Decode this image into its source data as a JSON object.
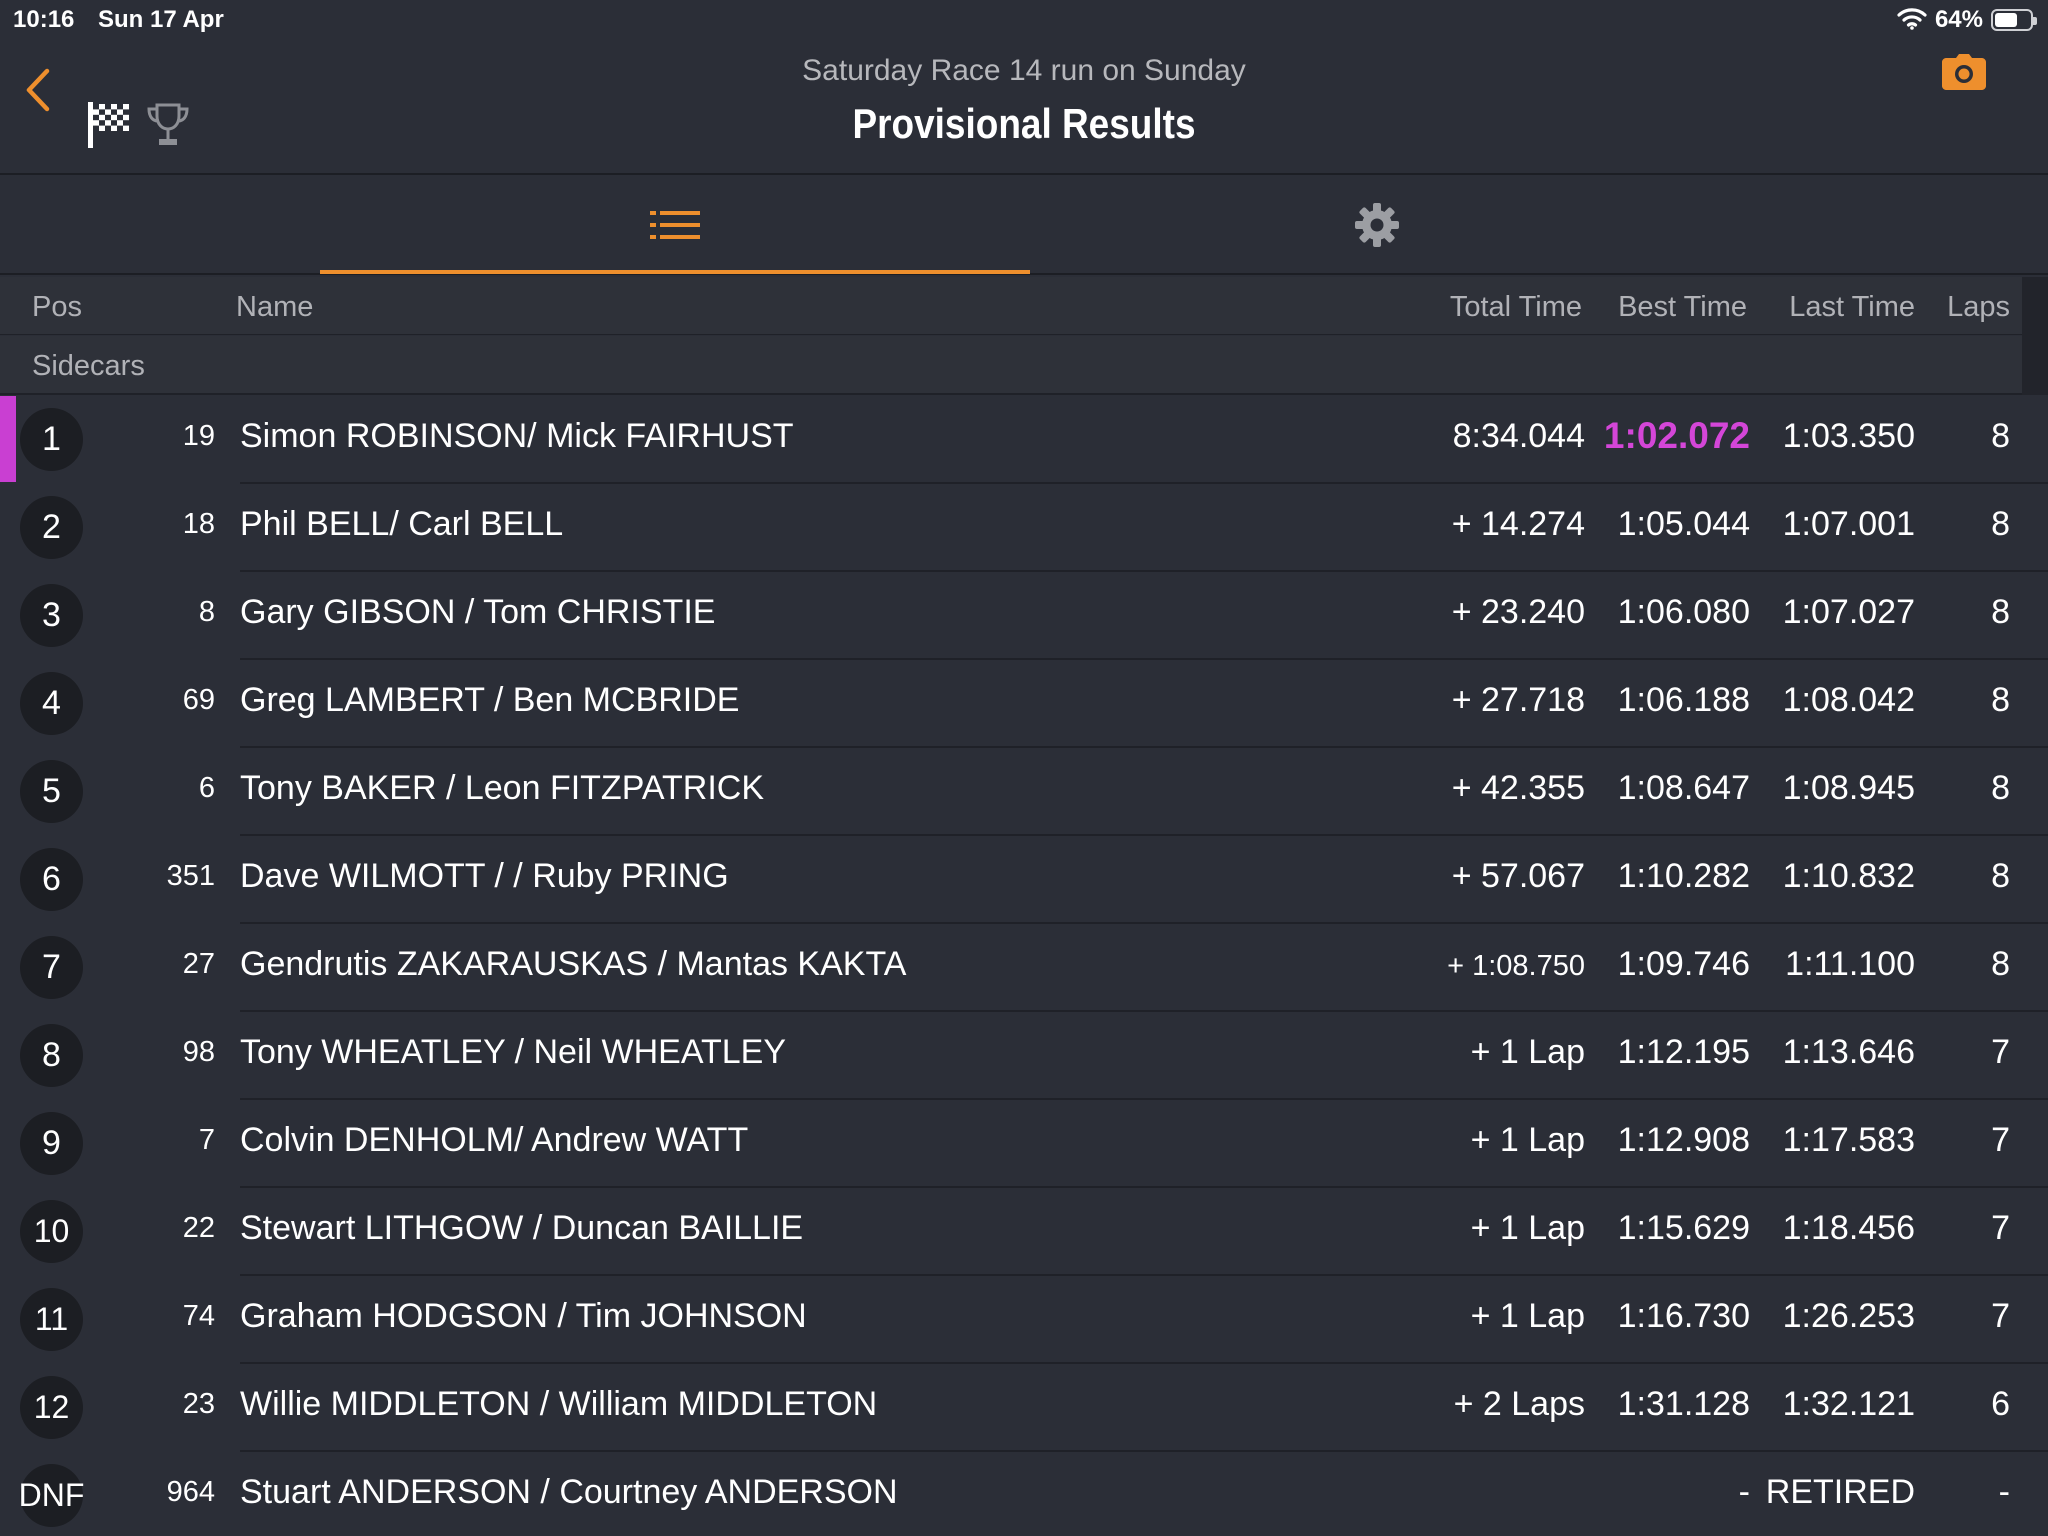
{
  "status_bar": {
    "time": "10:16",
    "date": "Sun 17 Apr",
    "battery": "64%",
    "battery_level": 0.64
  },
  "header": {
    "subtitle": "Saturday Race 14 run on Sunday",
    "title": "Provisional Results",
    "accent_color": "#ee8f2d"
  },
  "tabs": [
    {
      "icon": "list-icon",
      "active": true
    },
    {
      "icon": "gear-icon",
      "active": false
    }
  ],
  "columns": {
    "pos": "Pos",
    "name": "Name",
    "total": "Total Time",
    "best": "Best Time",
    "last": "Last Time",
    "laps": "Laps"
  },
  "category": "Sidecars",
  "fastest_color": "#d446d8",
  "rows": [
    {
      "pos": "1",
      "num": "19",
      "name": "Simon ROBINSON/ Mick FAIRHUST",
      "total": "8:34.044",
      "best": "1:02.072",
      "last": "1:03.350",
      "laps": "8"
    },
    {
      "pos": "2",
      "num": "18",
      "name": "Phil BELL/ Carl BELL",
      "total": "+ 14.274",
      "best": "1:05.044",
      "last": "1:07.001",
      "laps": "8"
    },
    {
      "pos": "3",
      "num": "8",
      "name": "Gary GIBSON / Tom CHRISTIE",
      "total": "+ 23.240",
      "best": "1:06.080",
      "last": "1:07.027",
      "laps": "8"
    },
    {
      "pos": "4",
      "num": "69",
      "name": "Greg LAMBERT / Ben MCBRIDE",
      "total": "+ 27.718",
      "best": "1:06.188",
      "last": "1:08.042",
      "laps": "8"
    },
    {
      "pos": "5",
      "num": "6",
      "name": "Tony BAKER / Leon FITZPATRICK",
      "total": "+ 42.355",
      "best": "1:08.647",
      "last": "1:08.945",
      "laps": "8"
    },
    {
      "pos": "6",
      "num": "351",
      "name": "Dave WILMOTT / / Ruby PRING",
      "total": "+ 57.067",
      "best": "1:10.282",
      "last": "1:10.832",
      "laps": "8"
    },
    {
      "pos": "7",
      "num": "27",
      "name": "Gendrutis ZAKARAUSKAS / Mantas KAKTA",
      "total": "+ 1:08.750",
      "best": "1:09.746",
      "last": "1:11.100",
      "laps": "8"
    },
    {
      "pos": "8",
      "num": "98",
      "name": "Tony WHEATLEY / Neil WHEATLEY",
      "total": "+ 1 Lap",
      "best": "1:12.195",
      "last": "1:13.646",
      "laps": "7"
    },
    {
      "pos": "9",
      "num": "7",
      "name": "Colvin DENHOLM/ Andrew WATT",
      "total": "+ 1 Lap",
      "best": "1:12.908",
      "last": "1:17.583",
      "laps": "7"
    },
    {
      "pos": "10",
      "num": "22",
      "name": "Stewart LITHGOW / Duncan BAILLIE",
      "total": "+ 1 Lap",
      "best": "1:15.629",
      "last": "1:18.456",
      "laps": "7"
    },
    {
      "pos": "11",
      "num": "74",
      "name": "Graham HODGSON / Tim JOHNSON",
      "total": "+ 1 Lap",
      "best": "1:16.730",
      "last": "1:26.253",
      "laps": "7"
    },
    {
      "pos": "12",
      "num": "23",
      "name": "Willie MIDDLETON / William MIDDLETON",
      "total": "+ 2 Laps",
      "best": "1:31.128",
      "last": "1:32.121",
      "laps": "6"
    },
    {
      "pos": "DNF",
      "num": "964",
      "name": "Stuart ANDERSON / Courtney ANDERSON",
      "total": "",
      "best": "-",
      "last": "RETIRED",
      "laps": "-"
    }
  ]
}
